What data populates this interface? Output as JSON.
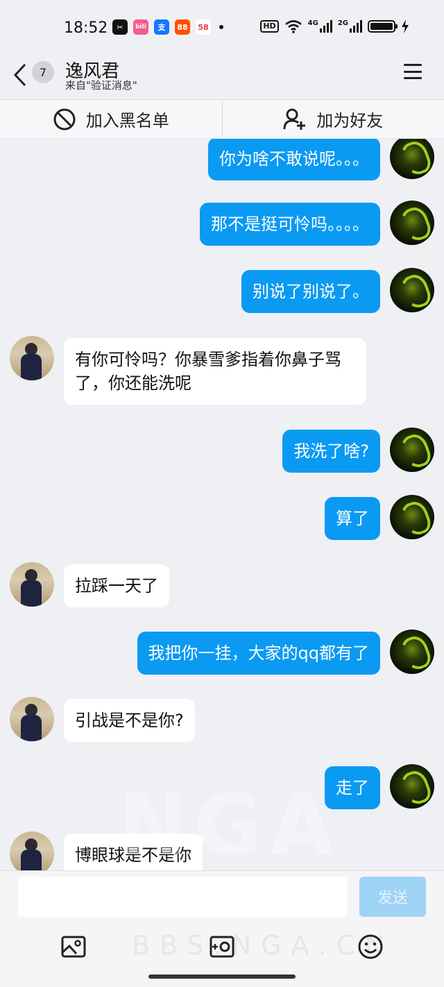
{
  "status": {
    "time": "18:52",
    "apps": [
      {
        "name": "capcut-icon",
        "label": "✂",
        "color": "#111111"
      },
      {
        "name": "bilibili-icon",
        "label": "bili",
        "color": "#f25d8e"
      },
      {
        "name": "alipay-icon",
        "label": "支",
        "color": "#1677ff"
      },
      {
        "name": "taobao-icon",
        "label": "88",
        "color": "#ff5000"
      },
      {
        "name": "58-icon",
        "label": "58",
        "color": "#ffffff"
      }
    ],
    "hd": "HD",
    "net1": "4G",
    "net2": "2G"
  },
  "header": {
    "back_badge": "7",
    "name": "逸风君",
    "subtitle": "来自\"验证消息\""
  },
  "actions": {
    "block_label": "加入黑名单",
    "add_friend_label": "加为好友"
  },
  "messages": [
    {
      "side": "me",
      "text": "你为啥不敢说呢。。。"
    },
    {
      "side": "me",
      "text": "那不是挺可怜吗。。。。"
    },
    {
      "side": "me",
      "text": "别说了别说了。"
    },
    {
      "side": "them",
      "text": "有你可怜吗？你暴雪爹指着你鼻子骂了，你还能洗呢"
    },
    {
      "side": "me",
      "text": "我洗了啥?"
    },
    {
      "side": "me",
      "text": "算了"
    },
    {
      "side": "them",
      "text": "拉踩一天了"
    },
    {
      "side": "me",
      "text": "我把你一挂，大家的qq都有了"
    },
    {
      "side": "them",
      "text": "引战是不是你?"
    },
    {
      "side": "me",
      "text": "走了"
    },
    {
      "side": "them",
      "text": "博眼球是不是你"
    }
  ],
  "composer": {
    "placeholder": "",
    "send_label": "发送"
  },
  "watermark": {
    "big": "NGA",
    "small": "BBS.NGA.CN"
  },
  "colors": {
    "my_bubble": "#0a9af2",
    "their_bubble": "#ffffff",
    "background": "#eff0f4"
  }
}
